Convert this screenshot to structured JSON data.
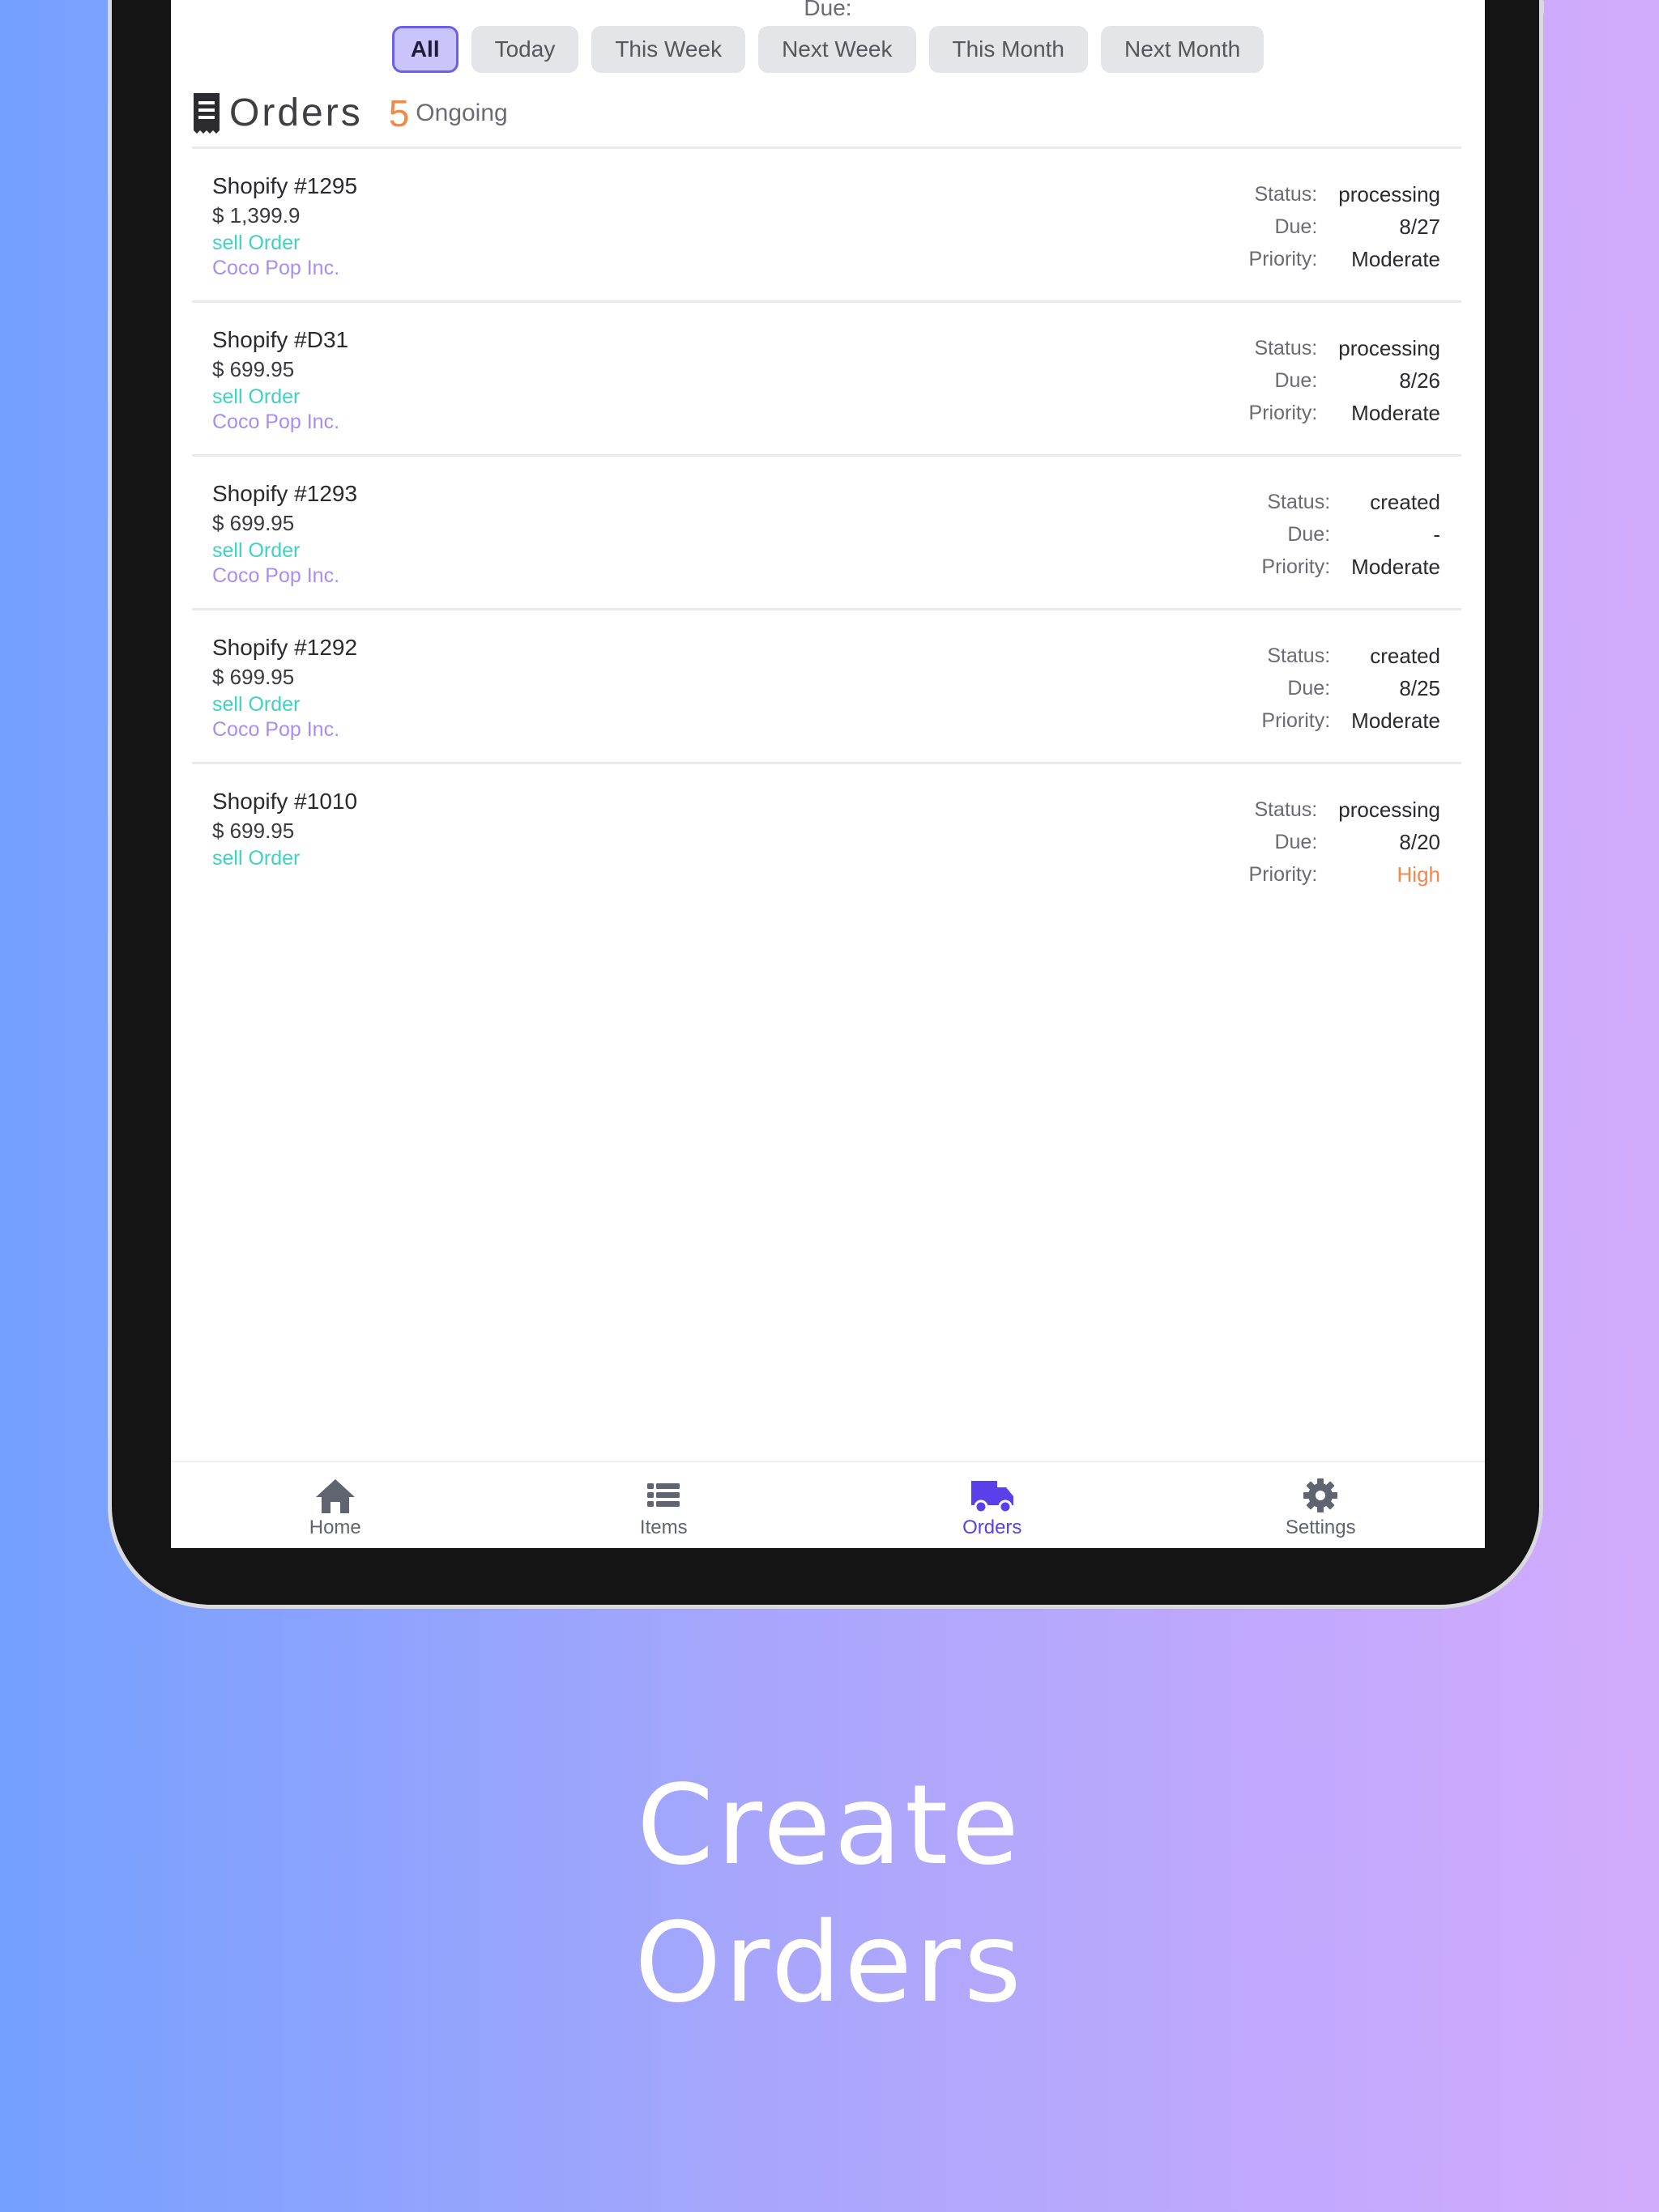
{
  "filter": {
    "due_label": "Due:",
    "chips": [
      "All",
      "Today",
      "This Week",
      "Next Week",
      "This Month",
      "Next Month"
    ]
  },
  "header": {
    "title": "Orders",
    "count": "5",
    "count_label": "Ongoing"
  },
  "orders": [
    {
      "name": "Shopify #1295",
      "price": "$ 1,399.9",
      "type": "sell Order",
      "company": "Coco Pop Inc.",
      "status": "processing",
      "due": "8/27",
      "priority": "Moderate"
    },
    {
      "name": "Shopify #D31",
      "price": "$ 699.95",
      "type": "sell Order",
      "company": "Coco Pop Inc.",
      "status": "processing",
      "due": "8/26",
      "priority": "Moderate"
    },
    {
      "name": "Shopify #1293",
      "price": "$ 699.95",
      "type": "sell Order",
      "company": "Coco Pop Inc.",
      "status": "created",
      "due": "-",
      "priority": "Moderate"
    },
    {
      "name": "Shopify #1292",
      "price": "$ 699.95",
      "type": "sell Order",
      "company": "Coco Pop Inc.",
      "status": "created",
      "due": "8/25",
      "priority": "Moderate"
    },
    {
      "name": "Shopify #1010",
      "price": "$ 699.95",
      "type": "sell Order",
      "company": "",
      "status": "processing",
      "due": "8/20",
      "priority": "High"
    }
  ],
  "field_labels": {
    "status": "Status:",
    "due": "Due:",
    "priority": "Priority:"
  },
  "nav": {
    "home": "Home",
    "items": "Items",
    "orders": "Orders",
    "settings": "Settings"
  },
  "tagline": {
    "line1": "Create",
    "line2": "Orders"
  },
  "colors": {
    "accent": "#5a40e8",
    "sell_order": "#3fd1c1",
    "company": "#a98df5",
    "high_priority": "#f4874b",
    "count": "#f08a4b"
  }
}
